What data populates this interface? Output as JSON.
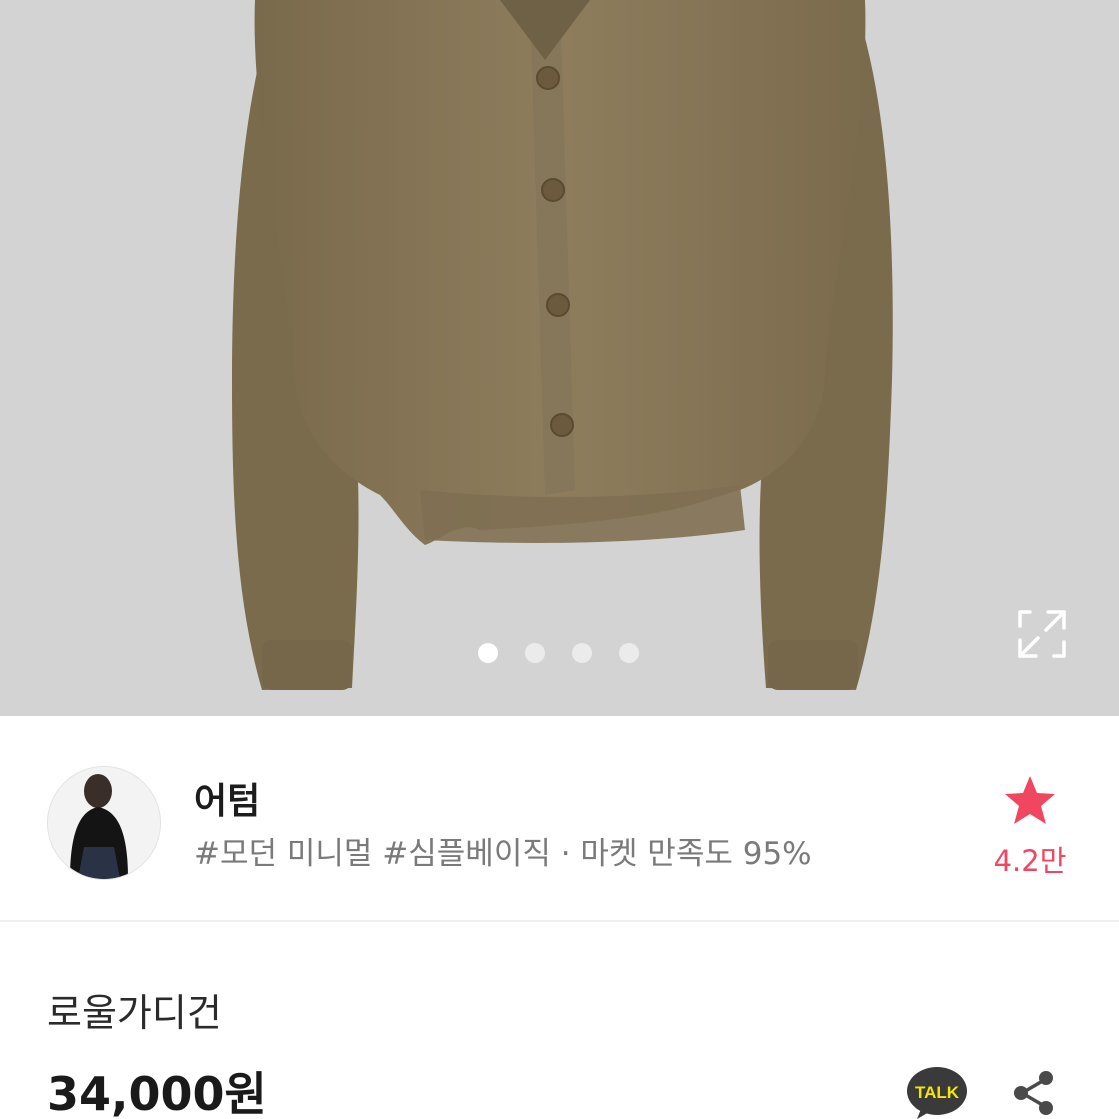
{
  "product_image": {
    "subject": "cardigan",
    "slide_count": 4,
    "active_slide": 1,
    "expand_icon": "expand-arrows-icon"
  },
  "seller": {
    "name": "어텀",
    "tags": "#모던 미니멀 #심플베이직 · 마켓 만족도 95%",
    "favorite_count": "4.2만",
    "favorite_icon": "star-icon",
    "accent_color": "#f0465f"
  },
  "product": {
    "name": "로울가디건",
    "price": "34,000원"
  },
  "actions": {
    "talk_label": "TALK",
    "talk_icon": "kakao-talk-icon",
    "share_icon": "share-icon"
  }
}
